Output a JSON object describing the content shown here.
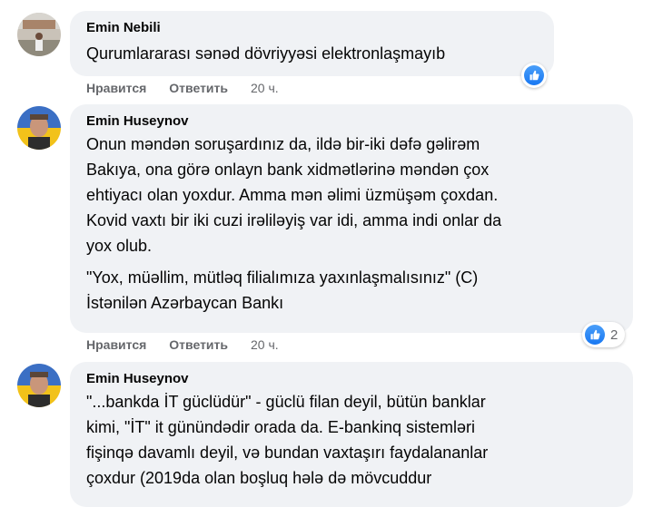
{
  "comments": [
    {
      "author": "Emin Nebili",
      "paragraphs": [
        "Qurumlararası sənəd dövriyyəsi elektronlaşmayıb"
      ],
      "reaction": {
        "icon": "like-icon",
        "count": ""
      },
      "actions": {
        "like": "Нравится",
        "reply": "Ответить",
        "time": "20 ч."
      }
    },
    {
      "author": "Emin Huseynov",
      "paragraphs": [
        "Onun məndən soruşardınız da, ildə bir-iki dəfə gəlirəm\nBakıya, ona görə onlayn bank xidmətlərinə məndən çox\nehtiyacı olan yoxdur. Amma mən əlimi üzmüşəm çoxdan.\nKovid vaxtı bir iki cuzi irəliləyiş var idi, amma indi onlar da\nyox olub.",
        "\"Yox, müəllim, mütləq filialımıza yaxınlaşmalısınız\" (C)\nİstənilən Azərbaycan Bankı"
      ],
      "reaction": {
        "icon": "like-icon",
        "count": "2"
      },
      "actions": {
        "like": "Нравится",
        "reply": "Ответить",
        "time": "20 ч."
      }
    },
    {
      "author": "Emin Huseynov",
      "paragraphs": [
        "\"...bankda İT güclüdür\" - güclü filan deyil, bütün banklar\nkimi, \"İT\" it günündədir orada da. E-bankinq sistemləri\nfişinqə davamlı deyil, və bundan vaxtaşırı faydalananlar\nçoxdur (2019da olan boşluq hələ də mövcuddur"
      ]
    }
  ],
  "colors": {
    "bubble": "#f0f2f5",
    "meta": "#65676b",
    "like_blue": "#1877f2"
  }
}
